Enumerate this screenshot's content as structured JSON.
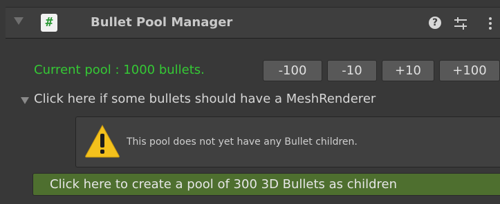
{
  "header": {
    "foldout_icon": "triangle-down-icon",
    "script_icon": "csharp-script-icon",
    "script_icon_glyph": "#",
    "title": "Bullet Pool Manager",
    "help_icon": "help-icon",
    "help_glyph": "?",
    "preset_icon": "preset-sliders-icon",
    "menu_icon": "kebab-menu-icon"
  },
  "pool": {
    "label": "Current pool : 1000 bullets.",
    "label_color": "#35c935",
    "buttons": [
      "-100",
      "-10",
      "+10",
      "+100"
    ]
  },
  "mesh_foldout": {
    "icon": "triangle-down-icon",
    "label": "Click here if some bullets should have a MeshRenderer"
  },
  "helpbox": {
    "icon": "warning-icon",
    "text": "This pool does not yet have any Bullet children."
  },
  "create_button": {
    "label": "Click here to create a pool of 300 3D Bullets as children",
    "color": "#4e6f2f"
  },
  "colors": {
    "background": "#383838",
    "header": "#3e3e3e",
    "button": "#585858",
    "warning": "#f4c11c"
  }
}
